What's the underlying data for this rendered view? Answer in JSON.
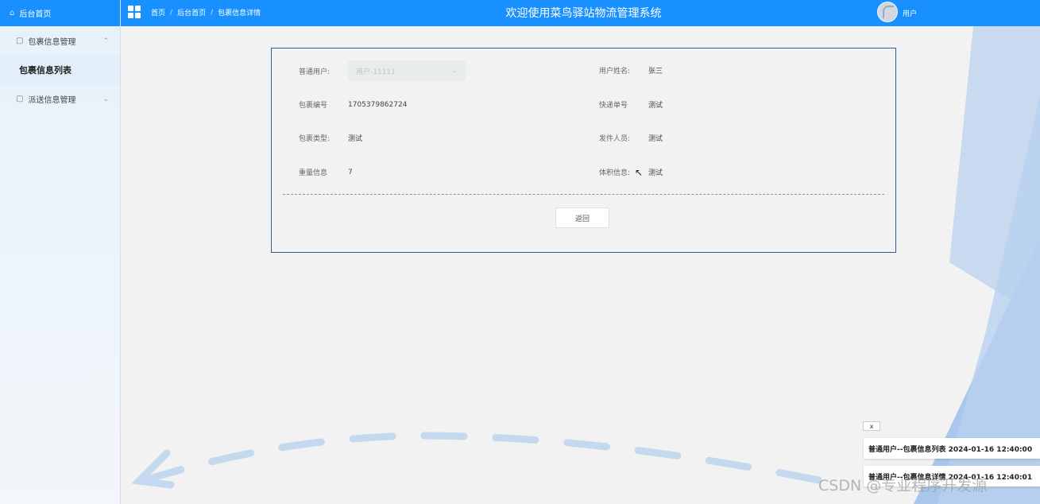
{
  "sidebar": {
    "home_label": "后台首页",
    "groups": [
      {
        "label": "包裹信息管理",
        "chevron": "⌃"
      },
      {
        "label": "派送信息管理",
        "chevron": "⌄"
      }
    ],
    "active_item": "包裹信息列表"
  },
  "header": {
    "breadcrumb": [
      "首页",
      "后台首页",
      "包裹信息详情"
    ],
    "breadcrumb_sep": "/",
    "title": "欢迎使用菜鸟驿站物流管理系统",
    "user_label": "用户"
  },
  "detail": {
    "user_select": {
      "label": "普通用户:",
      "value": "用户-11111"
    },
    "fields": [
      {
        "label": "用户姓名:",
        "value": "张三"
      },
      {
        "label": "包裹编号",
        "value": "1705379862724"
      },
      {
        "label": "快递单号",
        "value": "测试"
      },
      {
        "label": "包裹类型:",
        "value": "测试"
      },
      {
        "label": "发件人员:",
        "value": "测试"
      },
      {
        "label": "重量信息",
        "value": "7"
      },
      {
        "label": "体积信息:",
        "value": "测试"
      }
    ],
    "back_label": "返回"
  },
  "notifications": {
    "close_label": "x",
    "items": [
      "普通用户--包裹信息列表 2024-01-16 12:40:00",
      "普通用户--包裹信息详情 2024-01-16 12:40:01"
    ]
  },
  "watermark": "CSDN @专业程序开发源",
  "colors": {
    "primary": "#1890ff",
    "card_border": "#2f5d8c",
    "sidebar_active": "#e2effb"
  }
}
